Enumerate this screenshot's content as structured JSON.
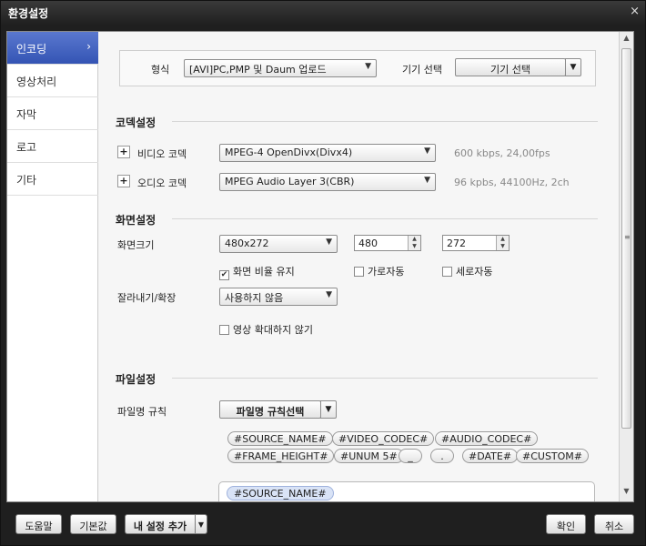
{
  "window": {
    "title": "환경설정",
    "close": "×"
  },
  "sidebar": {
    "items": [
      {
        "label": "인코딩",
        "active": true
      },
      {
        "label": "영상처리"
      },
      {
        "label": "자막"
      },
      {
        "label": "로고"
      },
      {
        "label": "기타"
      }
    ],
    "chevron": "›"
  },
  "format": {
    "label": "형식",
    "value": "[AVI]PC,PMP 및 Daum 업로드",
    "device_label": "기기 선택",
    "device_button": "기기 선택"
  },
  "codec": {
    "title": "코덱설정",
    "video": {
      "label": "비디오 코덱",
      "value": "MPEG-4 OpenDivx(Divx4)",
      "info": "600 kbps, 24,00fps"
    },
    "audio": {
      "label": "오디오 코덱",
      "value": "MPEG Audio Layer 3(CBR)",
      "info": "96 kpbs, 44100Hz, 2ch"
    },
    "plus": "+"
  },
  "screen": {
    "title": "화면설정",
    "size_label": "화면크기",
    "size_value": "480x272",
    "width": "480",
    "height": "272",
    "keep_ratio": {
      "label": "화면 비율 유지",
      "checked": true
    },
    "auto_width": {
      "label": "가로자동",
      "checked": false
    },
    "auto_height": {
      "label": "세로자동",
      "checked": false
    },
    "crop_label": "잘라내기/확장",
    "crop_value": "사용하지 않음",
    "no_upscale": {
      "label": "영상 확대하지 않기",
      "checked": false
    }
  },
  "file": {
    "title": "파일설정",
    "rule_label": "파일명 규칙",
    "rule_button": "파일명 규칙선택",
    "tokens_row1": [
      "#SOURCE_NAME#",
      "#VIDEO_CODEC#",
      "#AUDIO_CODEC#"
    ],
    "tokens_row2": [
      "#FRAME_HEIGHT#",
      "#UNUM 5#",
      "_",
      ".",
      "#DATE#",
      "#CUSTOM#"
    ],
    "current": "#SOURCE_NAME#"
  },
  "footer": {
    "help": "도움말",
    "defaults": "기본값",
    "add_preset": "내 설정 추가",
    "ok": "확인",
    "cancel": "취소"
  },
  "icons": {
    "check": "✔",
    "dropdown": "▼",
    "up": "▲",
    "down": "▼"
  }
}
